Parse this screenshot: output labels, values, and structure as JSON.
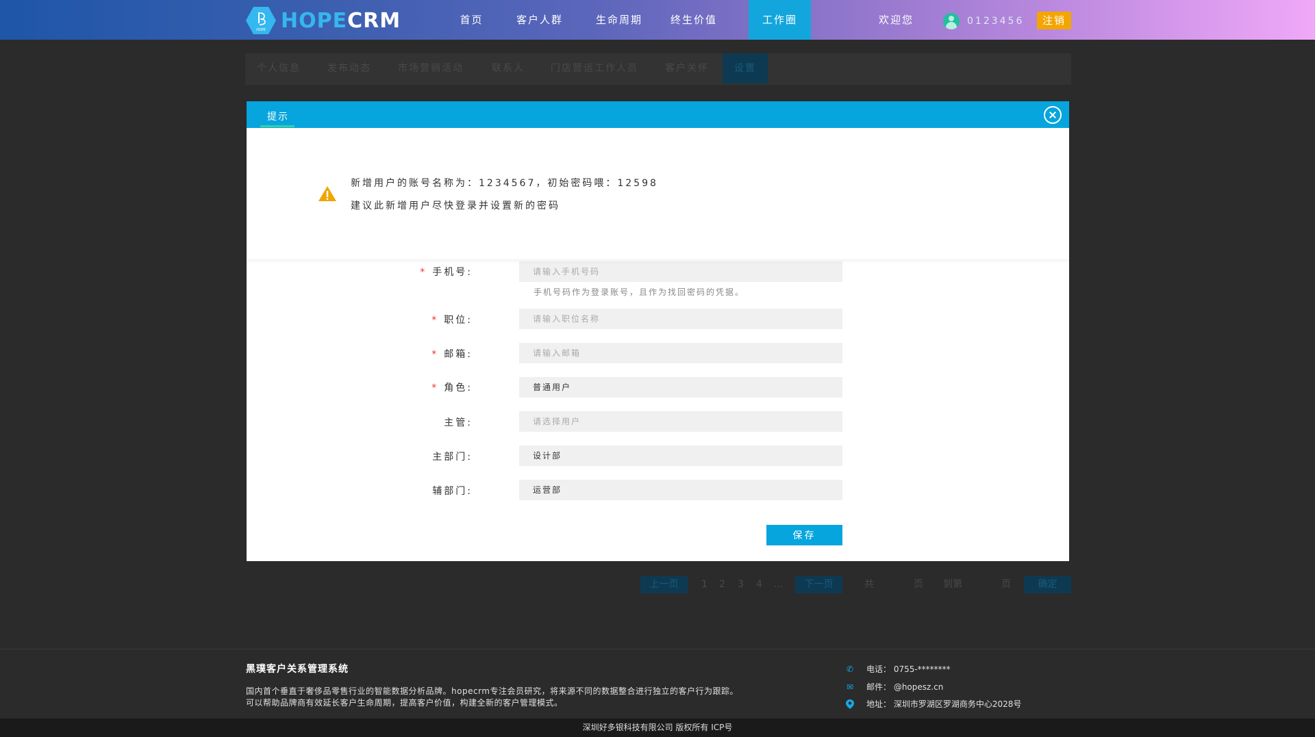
{
  "header": {
    "logo_hope": "HOPE",
    "logo_crm": "CRM",
    "logo_mark": "HOPE",
    "nav": [
      "首页",
      "客户人群",
      "生命周期",
      "终生价值",
      "工作圈"
    ],
    "welcome": "欢迎您",
    "username": "0123456",
    "logout": "注销"
  },
  "background": {
    "tabs": [
      "个人信息",
      "发布动态",
      "市场营销活动",
      "联系人",
      "门店营运工作人员",
      "客户关怀",
      "设置"
    ],
    "pager": {
      "prev": "上一页",
      "pages": [
        "1",
        "2",
        "3",
        "4",
        "..."
      ],
      "next": "下一页",
      "total_prefix": "共",
      "total_suffix": "页",
      "goto": "到第",
      "goto_suffix": "页",
      "confirm": "确定"
    }
  },
  "modal": {
    "title": "提示",
    "notice_line1": "新增用户的账号名称为：1234567，初始密码喂：12598",
    "notice_line2": "建议此新增用户尽快登录并设置新的密码",
    "form": {
      "phone_label": "手机号:",
      "phone_placeholder": "请输入手机号码",
      "phone_hint": "手机号码作为登录账号，且作为找回密码的凭据。",
      "position_label": "职位:",
      "position_placeholder": "请输入职位名称",
      "email_label": "邮箱:",
      "email_placeholder": "请输入邮箱",
      "role_label": "角色:",
      "role_value": "普通用户",
      "manager_label": "主管:",
      "manager_placeholder": "请选择用户",
      "main_dept_label": "主部门:",
      "main_dept_value": "设计部",
      "sub_dept_label": "辅部门:",
      "sub_dept_value": "运营部",
      "required_mark": "*"
    },
    "save": "保存"
  },
  "footer": {
    "title": "黑璞客户关系管理系统",
    "desc1": "国内首个垂直于奢侈品零售行业的智能数据分析品牌。hopecrm专注会员研究，将来源不同的数据整合进行独立的客户行为跟踪。",
    "desc2": "可以帮助品牌商有效延长客户生命周期，提高客户价值，构建全新的客户管理模式。",
    "phone": "电话：  0755-********",
    "email": "邮件：  @hopesz.cn",
    "address": "地址：  深圳市罗湖区罗湖商务中心2028号",
    "copyright": "深圳好多银科技有限公司 版权所有 ICP号"
  },
  "colors": {
    "accent": "#07a5dd",
    "logout": "#f3a500",
    "warning": "#f0a500",
    "required": "#e33333"
  }
}
